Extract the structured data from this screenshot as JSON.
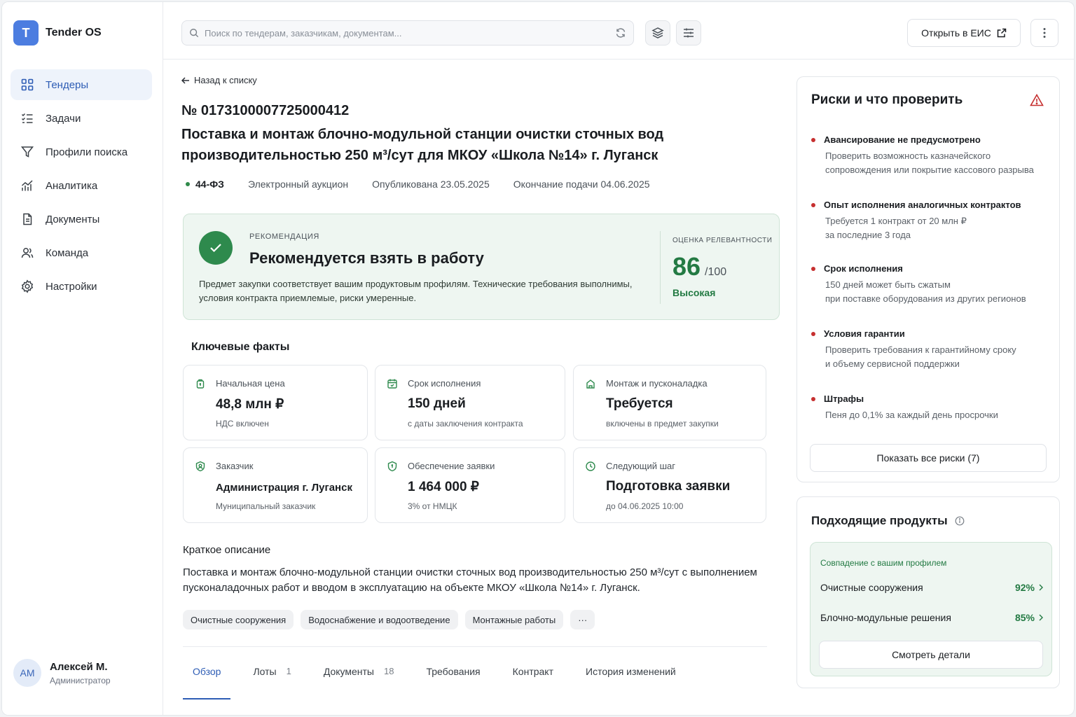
{
  "app": {
    "logo_letter": "T",
    "name": "Tender OS"
  },
  "sidebar": {
    "items": [
      {
        "label": "Тендеры",
        "icon": "grid-icon",
        "active": true
      },
      {
        "label": "Задачи",
        "icon": "checklist-icon"
      },
      {
        "label": "Профили поиска",
        "icon": "filter-icon"
      },
      {
        "label": "Аналитика",
        "icon": "chart-icon"
      },
      {
        "label": "Документы",
        "icon": "document-icon"
      },
      {
        "label": "Команда",
        "icon": "team-icon"
      },
      {
        "label": "Настройки",
        "icon": "gear-icon"
      }
    ]
  },
  "user": {
    "initials": "AM",
    "name": "Алексей М.",
    "role": "Администратор"
  },
  "topbar": {
    "search_placeholder": "Поиск по тендерам, заказчикам, документам...",
    "open_eis_label": "Открыть в ЕИС"
  },
  "tender": {
    "back_label": "Назад к списку",
    "number": "№ 0173100007725000412",
    "title": "Поставка и монтаж блочно-модульной станции очистки сточных вод производительностью 250 м³/сут для МКОУ «Школа №14» г. Луганск",
    "law": "44-ФЗ",
    "procedure": "Электронный аукцион",
    "published": "Опубликована 23.05.2025",
    "deadline": "Окончание подачи 04.06.2025"
  },
  "recommendation": {
    "label": "РЕКОМЕНДАЦИЯ",
    "title": "Рекомендуется взять в работу",
    "text": "Предмет закупки соответствует вашим продуктовым профилям. Технические требования выполнимы, условия контракта приемлемые, риски умеренные.",
    "score_label": "ОЦЕНКА РЕЛЕВАНТНОСТИ",
    "score": "86",
    "score_max": "/100",
    "score_level": "Высокая"
  },
  "facts": {
    "title": "Ключевые факты",
    "items": [
      {
        "label": "Начальная цена",
        "value": "48,8 млн ₽",
        "sub": "НДС включен",
        "icon": "price-tag-icon"
      },
      {
        "label": "Срок исполнения",
        "value": "150 дней",
        "sub": "с даты заключения контракта",
        "icon": "calendar-icon"
      },
      {
        "label": "Монтаж и пусконаладка",
        "value": "Требуется",
        "sub": "включены в предмет закупки",
        "icon": "tools-icon"
      },
      {
        "label": "Заказчик",
        "value": "Администрация г. Луганск",
        "sub": "Муниципальный заказчик",
        "icon": "customer-icon"
      },
      {
        "label": "Обеспечение заявки",
        "value": "1 464 000 ₽",
        "sub": "3% от НМЦК",
        "icon": "shield-icon"
      },
      {
        "label": "Следующий шаг",
        "value": "Подготовка заявки",
        "sub": "до 04.06.2025 10:00",
        "icon": "clock-icon"
      }
    ]
  },
  "description": {
    "title": "Краткое описание",
    "text": "Поставка и монтаж блочно-модульной станции очистки сточных вод производительностью 250 м³/сут с выполнением пусконаладочных работ и вводом в эксплуатацию на объекте МКОУ «Школа №14» г. Луганск.",
    "tags": [
      "Очистные сооружения",
      "Водоснабжение и водоотведение",
      "Монтажные работы",
      "···"
    ]
  },
  "tabs": [
    {
      "label": "Обзор",
      "count": "",
      "active": true
    },
    {
      "label": "Лоты",
      "count": "1"
    },
    {
      "label": "Документы",
      "count": "18"
    },
    {
      "label": "Требования",
      "count": ""
    },
    {
      "label": "Контракт",
      "count": ""
    },
    {
      "label": "История изменений",
      "count": ""
    }
  ],
  "risks": {
    "title": "Риски и что проверить",
    "items": [
      {
        "title": "Авансирование не предусмотрено",
        "lines": [
          "Проверить возможность казначейского",
          "сопровождения или покрытие кассового разрыва"
        ]
      },
      {
        "title": "Опыт исполнения аналогичных контрактов",
        "lines": [
          "Требуется 1 контракт от 20 млн ₽",
          "за последние 3 года"
        ]
      },
      {
        "title": "Срок исполнения",
        "lines": [
          "150 дней может быть сжатым",
          "при поставке оборудования из других регионов"
        ]
      },
      {
        "title": "Условия гарантии",
        "lines": [
          "Проверить требования к гарантийному сроку",
          "и объему сервисной поддержки"
        ]
      },
      {
        "title": "Штрафы",
        "lines": [
          "Пеня до 0,1% за каждый день просрочки"
        ]
      }
    ],
    "show_all_label": "Показать все риски (7)"
  },
  "products": {
    "title": "Подходящие продукты",
    "match_label": "Совпадение с вашим профилем",
    "items": [
      {
        "name": "Очистные сооружения",
        "pct": "92%"
      },
      {
        "name": "Блочно-модульные решения",
        "pct": "85%"
      }
    ],
    "details_label": "Смотреть детали"
  },
  "colors": {
    "accent": "#2e5db5",
    "success": "#237a43",
    "danger": "#c62f2f",
    "brand": "#4c7de0"
  }
}
